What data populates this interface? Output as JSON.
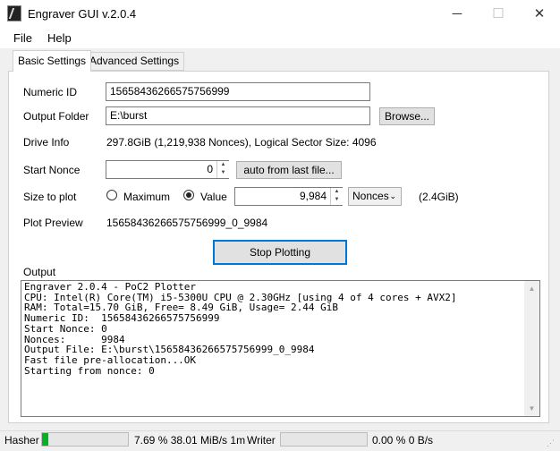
{
  "window": {
    "title": "Engraver GUI v.2.0.4",
    "minimize": "─",
    "maximize": "☐",
    "close": "✕"
  },
  "menu": [
    "File",
    "Help"
  ],
  "tabs": [
    "Basic Settings",
    "Advanced Settings"
  ],
  "form": {
    "numeric_id_label": "Numeric ID",
    "numeric_id_value": "15658436266575756999",
    "output_folder_label": "Output Folder",
    "output_folder_value": "E:\\burst",
    "browse_label": "Browse...",
    "drive_info_label": "Drive Info",
    "drive_info_value": "297.8GiB (1,219,938 Nonces), Logical Sector Size: 4096",
    "start_nonce_label": "Start Nonce",
    "start_nonce_value": "0",
    "auto_button_label": "auto from last file...",
    "size_label": "Size to plot",
    "radio_maximum": "Maximum",
    "radio_value": "Value",
    "radio_selected": "Value",
    "size_value": "9,984",
    "unit_selected": "Nonces",
    "size_gib": "(2.4GiB)",
    "preview_label": "Plot Preview",
    "preview_value": "15658436266575756999_0_9984",
    "stop_button_label": "Stop Plotting",
    "output_label": "Output"
  },
  "output_lines": [
    "Engraver 2.0.4 - PoC2 Plotter",
    "CPU: Intel(R) Core(TM) i5-5300U CPU @ 2.30GHz [using 4 of 4 cores + AVX2]",
    "RAM: Total=15.70 GiB, Free= 8.49 GiB, Usage= 2.44 GiB",
    "Numeric ID:  15658436266575756999",
    "Start Nonce: 0",
    "Nonces:      9984",
    "Output File: E:\\burst\\15658436266575756999_0_9984",
    "Fast file pre-allocation...OK",
    "Starting from nonce: 0"
  ],
  "status": {
    "hasher_label": "Hasher",
    "hasher_progress": 0.0769,
    "hasher_text": "7.69 % 38.01 MiB/s 1m",
    "writer_label": "Writer",
    "writer_progress": 0,
    "writer_text": "0.00 % 0 B/s",
    "accent": "#06b025"
  }
}
